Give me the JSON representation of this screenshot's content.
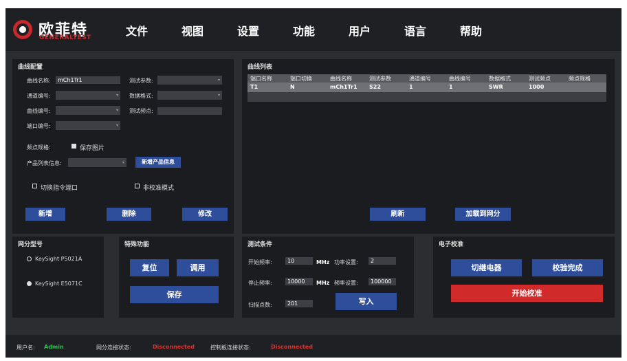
{
  "colors": {
    "accent_blue": "#2e4d9b",
    "accent_red": "#d12a2a",
    "brand_red": "#c8282c",
    "ok_green": "#27c24c",
    "bad_red": "#e0302c"
  },
  "header": {
    "logo_cn": "欧菲特",
    "logo_en": "GENERALTEST",
    "menu": [
      "文件",
      "视图",
      "设置",
      "功能",
      "用户",
      "语言",
      "帮助"
    ]
  },
  "curve_config": {
    "title": "曲线配置",
    "curve_name_label": "曲线名称:",
    "curve_name_value": "mCh1Tr1",
    "test_param_label": "测试参数:",
    "channel_label": "通道编号:",
    "data_format_label": "数据格式:",
    "curve_no_label": "曲线编号:",
    "test_point_label": "测试频点:",
    "port_label": "端口编号:",
    "spec_label": "频点规格:",
    "save_image_label": "保存图片",
    "product_list_label": "产品列表信息:",
    "new_product_button": "新增产品信息",
    "switch_port_label": "切换指令端口",
    "non_calib_label": "非校准模式",
    "add_button": "新增",
    "delete_button": "删除",
    "modify_button": "修改"
  },
  "curve_list": {
    "title": "曲线列表",
    "columns": [
      "端口名称",
      "端口切换",
      "曲线名称",
      "测试参数",
      "通道编号",
      "曲线编号",
      "数据格式",
      "测试频点",
      "频点规格"
    ],
    "rows": [
      [
        "T1",
        "N",
        "mCh1Tr1",
        "S22",
        "1",
        "1",
        "SWR",
        "1000",
        ""
      ]
    ],
    "refresh_button": "刷新",
    "load_button": "加载到网分"
  },
  "analyzer": {
    "title": "网分型号",
    "options": [
      "KeySight P5021A",
      "KeySight E5071C"
    ],
    "selected": 1
  },
  "special": {
    "title": "特殊功能",
    "reset_button": "复位",
    "call_button": "调用",
    "save_button": "保存"
  },
  "test_cond": {
    "title": "测试条件",
    "start_freq_label": "开始频率:",
    "start_freq_value": "10",
    "stop_freq_label": "停止频率:",
    "stop_freq_value": "10000",
    "unit_mhz": "MHz",
    "power_label": "功率设置:",
    "power_value": "2",
    "bandwidth_label": "频率设置:",
    "bandwidth_value": "100000",
    "points_label": "扫描点数:",
    "points_value": "201",
    "write_button": "写入"
  },
  "ecal": {
    "title": "电子校准",
    "switch_button": "切继电器",
    "verify_button": "校验完成",
    "start_button": "开始校准"
  },
  "status": {
    "user_label": "用户名:",
    "user_value": "Admin",
    "vna_label": "网分连接状态:",
    "vna_value": "Disconnected",
    "ctrl_label": "控制板连接状态:",
    "ctrl_value": "Disconnected"
  }
}
